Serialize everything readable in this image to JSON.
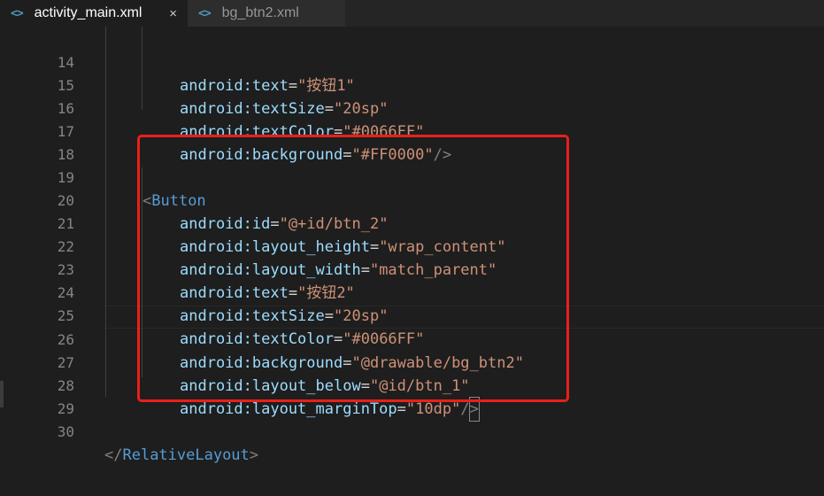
{
  "tabs": [
    {
      "label": "activity_main.xml",
      "icon": "code-brackets-icon",
      "close": "×",
      "active": true
    },
    {
      "label": "bg_btn2.xml",
      "icon": "code-brackets-icon",
      "active": false
    }
  ],
  "icon_glyph": "<>",
  "colors": {
    "background": "#1e1e1e",
    "attribute": "#9cdcfe",
    "string": "#ce9178",
    "tag": "#569cd6",
    "highlight_box": "#e8201a"
  },
  "lines": [
    {
      "num": "14",
      "attr": "android:text",
      "val": "\"按钮1\""
    },
    {
      "num": "15",
      "attr": "android:textSize",
      "val": "\"20sp\""
    },
    {
      "num": "16",
      "attr": "android:textColor",
      "val": "\"#0066FF\""
    },
    {
      "num": "17",
      "attr": "android:background",
      "val": "\"#FF0000\"",
      "tail": "/>"
    },
    {
      "num": "18"
    },
    {
      "num": "19",
      "open": "<",
      "tag": "Button"
    },
    {
      "num": "20",
      "attr": "android:id",
      "val": "\"@+id/btn_2\""
    },
    {
      "num": "21",
      "attr": "android:layout_height",
      "val": "\"wrap_content\""
    },
    {
      "num": "22",
      "attr": "android:layout_width",
      "val": "\"match_parent\""
    },
    {
      "num": "23",
      "attr": "android:text",
      "val": "\"按钮2\""
    },
    {
      "num": "24",
      "attr": "android:textSize",
      "val": "\"20sp\""
    },
    {
      "num": "25",
      "attr": "android:textColor",
      "val": "\"#0066FF\""
    },
    {
      "num": "26",
      "attr": "android:background",
      "val": "\"@drawable/bg_btn2\""
    },
    {
      "num": "27",
      "attr": "android:layout_below",
      "val": "\"@id/btn_1\""
    },
    {
      "num": "28",
      "attr": "android:layout_marginTop",
      "val": "\"10dp\"",
      "tail_slash": "/",
      "tail_bracket": ">"
    },
    {
      "num": "29"
    },
    {
      "num": "30",
      "open": "</",
      "tag": "RelativeLayout",
      "close": ">"
    }
  ]
}
